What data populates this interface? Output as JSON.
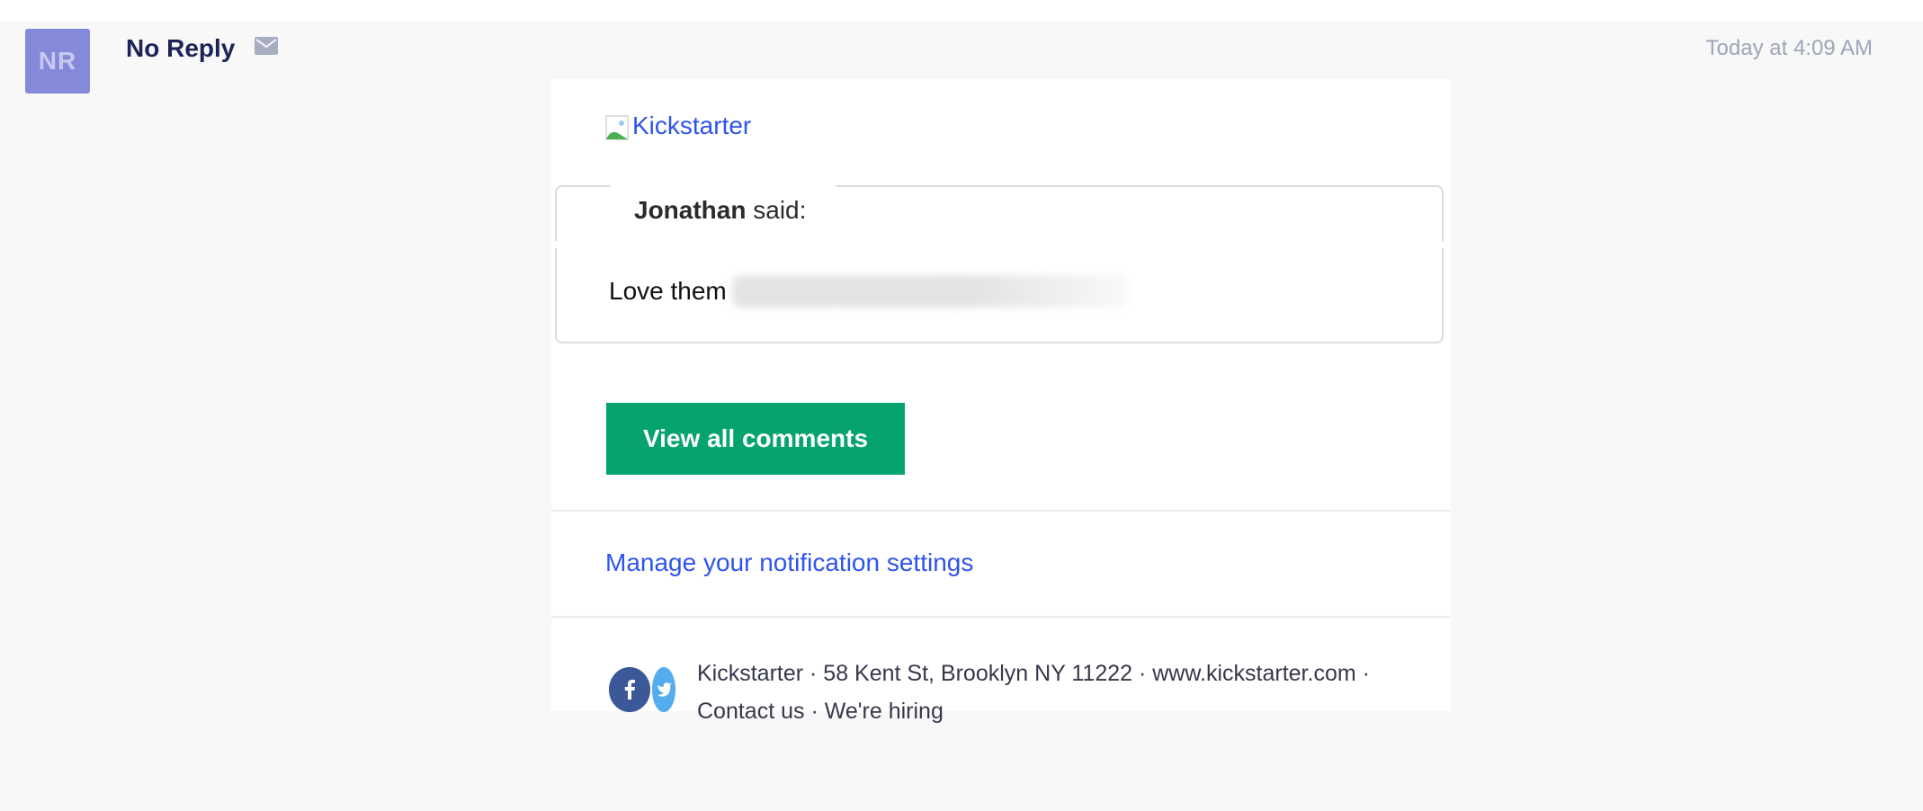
{
  "header": {
    "avatar_initials": "NR",
    "sender": "No Reply",
    "timestamp": "Today at 4:09 AM"
  },
  "email": {
    "logo_alt": "Kickstarter",
    "comment": {
      "author": "Jonathan",
      "said_suffix": " said:",
      "text_visible": "Love them"
    },
    "cta_label": "View all comments",
    "manage_link": "Manage your notification settings",
    "footer": {
      "line1": "Kickstarter · 58 Kent St, Brooklyn NY 11222 · www.kickstarter.com ·",
      "line2": "Contact us · We're hiring"
    }
  },
  "icons": {
    "envelope": "envelope-icon",
    "facebook": "facebook-icon",
    "twitter": "twitter-icon"
  },
  "colors": {
    "avatar_bg": "#8489da",
    "cta_bg": "#05a36f",
    "link": "#2f54eb",
    "sender": "#1c2457",
    "facebook": "#3b5998",
    "twitter": "#55acee"
  }
}
